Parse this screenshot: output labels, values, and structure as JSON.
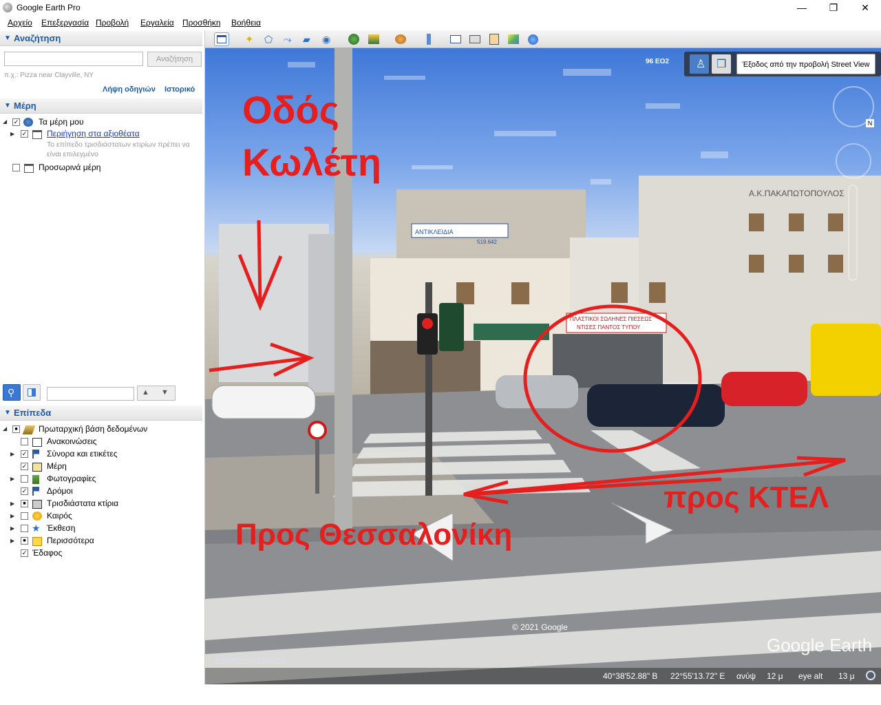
{
  "window": {
    "title": "Google Earth Pro",
    "min_glyph": "—",
    "max_glyph": "❐",
    "close_glyph": "✕"
  },
  "menu": [
    "Αρχείο",
    "Επεξεργασία",
    "Προβολή",
    "Εργαλεία",
    "Προσθήκη",
    "Βοήθεια"
  ],
  "search": {
    "header": "Αναζήτηση",
    "placeholder": "",
    "button": "Αναζήτηση",
    "hint": "π.χ.: Pizza near Clayville, NY",
    "directions_link": "Λήψη οδηγιών",
    "history_link": "Ιστορικό"
  },
  "places": {
    "header": "Μέρη",
    "items": [
      {
        "label": "Τα μέρη μου",
        "checked": "✓"
      },
      {
        "label": "Περιήγηση στα αξιοθέατα",
        "checked": "✓"
      },
      {
        "note": "Το επίπεδο τρισδιάστατων κτιρίων πρέπει να είναι επιλεγμένο"
      },
      {
        "label": "Προσωρινά μέρη",
        "checked": ""
      }
    ]
  },
  "layers": {
    "header": "Επίπεδα",
    "root": "Πρωταρχική βάση δεδομένων",
    "items": [
      {
        "label": "Ανακοινώσεις",
        "checked": ""
      },
      {
        "label": "Σύνορα και ετικέτες",
        "checked": "✓"
      },
      {
        "label": "Μέρη",
        "checked": "✓"
      },
      {
        "label": "Φωτογραφίες",
        "checked": ""
      },
      {
        "label": "Δρόμοι",
        "checked": "✓"
      },
      {
        "label": "Τρισδιάστατα κτίρια",
        "checked": "■"
      },
      {
        "label": "Καιρός",
        "checked": ""
      },
      {
        "label": "Έκθεση",
        "checked": ""
      },
      {
        "label": "Περισσότερα",
        "checked": "■"
      },
      {
        "label": "Έδαφος",
        "checked": "✓"
      }
    ]
  },
  "streetview": {
    "road_label": "96 ΕΟ2",
    "exit_button": "Έξοδος από την προβολή Street View"
  },
  "annotations": {
    "street_line1": "Οδός",
    "street_line2": "Κωλέτη",
    "to_thessaloniki": "Προς Θεσσαλονίκη",
    "to_ktel": "προς ΚΤΕΛ"
  },
  "signs": {
    "building": "Α.Κ.ΠΑΚΑΠΩΤΟΠΟΥΛΟΣ",
    "shop": "ΠΛΑΣΤΙΚΟΙ ΣΩΛΗΝΕΣ ΠΙΕΣΕΩΣ",
    "shop2": "ΝΤΙΣΕΣ ΠΑΝΤΟΣ ΤΥΠΟΥ",
    "shop3": "ΑΝΤΙΚΛΕΙΔΙΑ",
    "phone": "519.642"
  },
  "map_footer": {
    "copyright": "© 2021 Google",
    "brand": "Google Earth",
    "report": "Αναφορά προβλήματος",
    "lat": "40°38'52.88\" Β",
    "lon": "22°55'13.72\" Ε",
    "elev_label": "ανύψ",
    "elev": "12 μ",
    "eye_label": "eye alt",
    "eye": "13 μ"
  }
}
